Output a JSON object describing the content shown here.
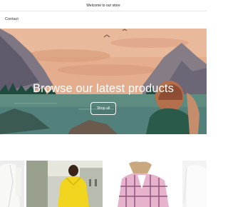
{
  "announcement": {
    "text": "Welcome to our store"
  },
  "header": {
    "nav": [
      {
        "label": "Contact"
      }
    ]
  },
  "hero": {
    "heading": "Browse our latest products",
    "button_label": "Shop all",
    "colors": {
      "sky": "#e9b796",
      "water": "#5f8f84",
      "mountain": "#7e7a86",
      "trees": "#1f4b3e",
      "jacket": "#2a5a4a"
    }
  },
  "products": [
    {
      "image": "white-blazer-photo"
    },
    {
      "image": "yellow-hoodie-photo"
    },
    {
      "image": "pink-plaid-shirt-photo"
    },
    {
      "image": "white-top-photo"
    }
  ]
}
